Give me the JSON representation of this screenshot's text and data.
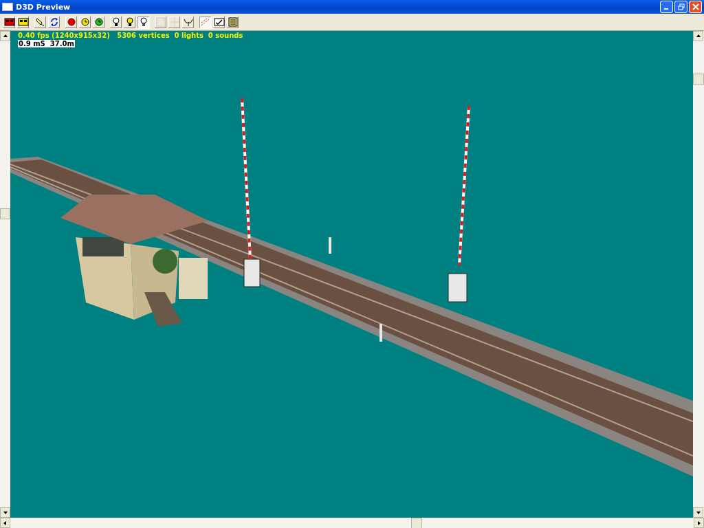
{
  "window": {
    "title": "D3D Preview"
  },
  "toolbar": {
    "groups": [
      [
        {
          "kind": "red-squares",
          "pressed": false,
          "disabled": false
        },
        {
          "kind": "yellow-squares",
          "pressed": false,
          "disabled": false
        }
      ],
      [
        {
          "kind": "lamp",
          "pressed": false,
          "disabled": false
        },
        {
          "kind": "refresh",
          "pressed": false,
          "disabled": false
        }
      ],
      [
        {
          "kind": "red-dot",
          "pressed": false,
          "disabled": false
        },
        {
          "kind": "yellow-dot",
          "pressed": false,
          "disabled": false
        },
        {
          "kind": "green-dot",
          "pressed": false,
          "disabled": false
        }
      ],
      [
        {
          "kind": "bulb-off",
          "pressed": false,
          "disabled": false
        },
        {
          "kind": "bulb-yellow",
          "pressed": false,
          "disabled": false
        },
        {
          "kind": "bulb-white",
          "pressed": true,
          "disabled": false
        }
      ],
      [
        {
          "kind": "frame",
          "pressed": false,
          "disabled": true
        },
        {
          "kind": "cross",
          "pressed": false,
          "disabled": true
        },
        {
          "kind": "wings",
          "pressed": false,
          "disabled": false
        }
      ],
      [
        {
          "kind": "dots",
          "pressed": true,
          "disabled": false
        },
        {
          "kind": "check",
          "pressed": false,
          "disabled": false
        },
        {
          "kind": "lines",
          "pressed": false,
          "disabled": false
        }
      ]
    ]
  },
  "viewport": {
    "stats": "0.40 fps (1240x915x32)   5306 vertices  0 lights  0 sounds",
    "timing": "0.9 mS  37.0m"
  }
}
